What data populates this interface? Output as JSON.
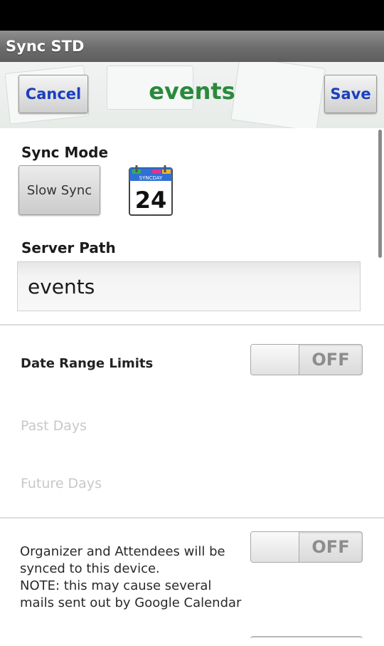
{
  "titlebar": {
    "title": "Sync STD"
  },
  "header": {
    "cancel_label": "Cancel",
    "title": "events",
    "save_label": "Save"
  },
  "sync_mode": {
    "label": "Sync Mode",
    "button_label": "Slow Sync",
    "calendar_header": "SYNCDAY",
    "calendar_day": "24"
  },
  "server_path": {
    "label": "Server Path",
    "value": "events"
  },
  "date_range": {
    "label": "Date Range Limits",
    "toggle_state": "OFF",
    "past_days": "Past Days",
    "future_days": "Future Days"
  },
  "attendees": {
    "note_lines": [
      "Organizer and Attendees will be",
      "synced to this device.",
      "NOTE: this may cause several",
      "mails sent out by Google Calendar"
    ],
    "toggle_state": "OFF"
  },
  "colors": {
    "accent_green": "#2a8a3c",
    "button_blue": "#1a3fbf"
  }
}
